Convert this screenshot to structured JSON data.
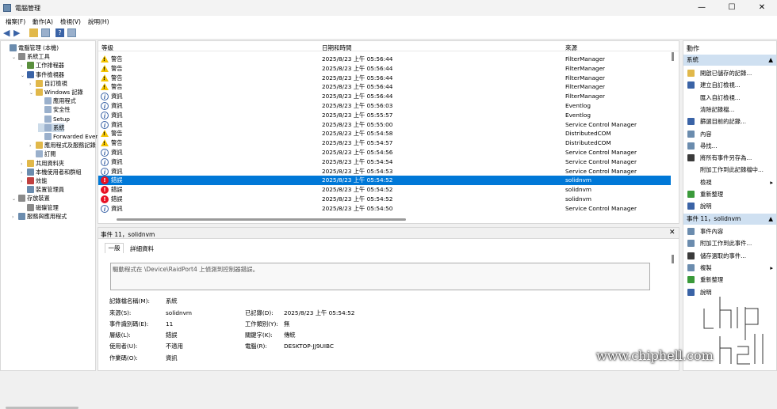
{
  "window": {
    "title": "電腦管理",
    "minimize": "—",
    "maximize": "☐",
    "close": "✕"
  },
  "menu": [
    "檔案(F)",
    "動作(A)",
    "檢視(V)",
    "說明(H)"
  ],
  "tree": [
    {
      "label": "電腦管理 (本機)",
      "indent": 0,
      "tw": "",
      "icon": "#6b8cae"
    },
    {
      "label": "系統工具",
      "indent": 1,
      "tw": "v",
      "icon": "#8a8a8a"
    },
    {
      "label": "工作排程器",
      "indent": 2,
      "tw": ">",
      "icon": "#5a8f3e"
    },
    {
      "label": "事件檢視器",
      "indent": 2,
      "tw": "v",
      "icon": "#3a63a6"
    },
    {
      "label": "自訂檢視",
      "indent": 3,
      "tw": ">",
      "icon": "#e1b84a"
    },
    {
      "label": "Windows 記錄",
      "indent": 3,
      "tw": "v",
      "icon": "#e1b84a"
    },
    {
      "label": "應用程式",
      "indent": 4,
      "tw": "",
      "icon": "#9ab0cc"
    },
    {
      "label": "安全性",
      "indent": 4,
      "tw": "",
      "icon": "#9ab0cc"
    },
    {
      "label": "Setup",
      "indent": 4,
      "tw": "",
      "icon": "#9ab0cc"
    },
    {
      "label": "系統",
      "indent": 4,
      "tw": "",
      "icon": "#9ab0cc",
      "selected": true
    },
    {
      "label": "Forwarded Even",
      "indent": 4,
      "tw": "",
      "icon": "#9ab0cc"
    },
    {
      "label": "應用程式及服務記錄",
      "indent": 3,
      "tw": ">",
      "icon": "#e1b84a"
    },
    {
      "label": "訂閱",
      "indent": 3,
      "tw": "",
      "icon": "#9ab0cc"
    },
    {
      "label": "共用資料夾",
      "indent": 2,
      "tw": ">",
      "icon": "#e1b84a"
    },
    {
      "label": "本機使用者和群組",
      "indent": 2,
      "tw": ">",
      "icon": "#6b8cae"
    },
    {
      "label": "效能",
      "indent": 2,
      "tw": ">",
      "icon": "#c04040"
    },
    {
      "label": "裝置管理員",
      "indent": 2,
      "tw": "",
      "icon": "#6b8cae"
    },
    {
      "label": "存放裝置",
      "indent": 1,
      "tw": "v",
      "icon": "#8a8a8a"
    },
    {
      "label": "磁碟管理",
      "indent": 2,
      "tw": "",
      "icon": "#8a8a8a"
    },
    {
      "label": "服務與應用程式",
      "indent": 1,
      "tw": ">",
      "icon": "#6b8cae"
    }
  ],
  "events": {
    "columns": [
      "等級",
      "日期和時間",
      "來源"
    ],
    "rows": [
      {
        "level": "警告",
        "type": "warn",
        "time": "2025/8/23 上午 05:56:44",
        "source": "FilterManager"
      },
      {
        "level": "警告",
        "type": "warn",
        "time": "2025/8/23 上午 05:56:44",
        "source": "FilterManager"
      },
      {
        "level": "警告",
        "type": "warn",
        "time": "2025/8/23 上午 05:56:44",
        "source": "FilterManager"
      },
      {
        "level": "警告",
        "type": "warn",
        "time": "2025/8/23 上午 05:56:44",
        "source": "FilterManager"
      },
      {
        "level": "資訊",
        "type": "info",
        "time": "2025/8/23 上午 05:56:44",
        "source": "FilterManager"
      },
      {
        "level": "資訊",
        "type": "info",
        "time": "2025/8/23 上午 05:56:03",
        "source": "Eventlog"
      },
      {
        "level": "資訊",
        "type": "info",
        "time": "2025/8/23 上午 05:55:57",
        "source": "Eventlog"
      },
      {
        "level": "資訊",
        "type": "info",
        "time": "2025/8/23 上午 05:55:00",
        "source": "Service Control Manager"
      },
      {
        "level": "警告",
        "type": "warn",
        "time": "2025/8/23 上午 05:54:58",
        "source": "DistributedCOM"
      },
      {
        "level": "警告",
        "type": "warn",
        "time": "2025/8/23 上午 05:54:57",
        "source": "DistributedCOM"
      },
      {
        "level": "資訊",
        "type": "info",
        "time": "2025/8/23 上午 05:54:56",
        "source": "Service Control Manager"
      },
      {
        "level": "資訊",
        "type": "info",
        "time": "2025/8/23 上午 05:54:54",
        "source": "Service Control Manager"
      },
      {
        "level": "資訊",
        "type": "info",
        "time": "2025/8/23 上午 05:54:53",
        "source": "Service Control Manager"
      },
      {
        "level": "錯誤",
        "type": "err",
        "time": "2025/8/23 上午 05:54:52",
        "source": "solidnvm",
        "selected": true
      },
      {
        "level": "錯誤",
        "type": "err",
        "time": "2025/8/23 上午 05:54:52",
        "source": "solidnvm"
      },
      {
        "level": "錯誤",
        "type": "err",
        "time": "2025/8/23 上午 05:54:52",
        "source": "solidnvm"
      },
      {
        "level": "資訊",
        "type": "info",
        "time": "2025/8/23 上午 05:54:50",
        "source": "Service Control Manager"
      }
    ]
  },
  "detail": {
    "header": "事件 11，solidnvm",
    "tabs": [
      "一般",
      "詳細資料"
    ],
    "message": "驅動程式在 \\Device\\RaidPort4 上偵測到控制器錯誤。",
    "labels": {
      "log_name": "記錄檔名稱(M):",
      "source": "來源(S):",
      "event_id": "事件識別碼(E):",
      "level": "層級(L):",
      "user": "使用者(U):",
      "opcode": "作業碼(O):",
      "logged": "已記錄(D):",
      "task": "工作類別(Y):",
      "keywords": "關鍵字(K):",
      "computer": "電腦(R):"
    },
    "values": {
      "log_name": "系統",
      "source": "solidnvm",
      "event_id": "11",
      "level": "錯誤",
      "user": "不適用",
      "opcode": "資訊",
      "logged": "2025/8/23 上午 05:54:52",
      "task": "無",
      "keywords": "傳統",
      "computer": "DESKTOP-JJ9UIBC"
    }
  },
  "actions": {
    "title": "動作",
    "section1": "系統",
    "items1": [
      {
        "label": "開啟已儲存的記錄...",
        "icon": "#e1b84a"
      },
      {
        "label": "建立自訂檢視...",
        "icon": "#3a63a6"
      },
      {
        "label": "匯入自訂檢視...",
        "icon": ""
      },
      {
        "label": "清除記錄檔...",
        "icon": ""
      },
      {
        "label": "篩選目前的記錄...",
        "icon": "#3a63a6"
      },
      {
        "label": "內容",
        "icon": "#6b8cae"
      },
      {
        "label": "尋找...",
        "icon": "#6b8cae"
      },
      {
        "label": "將所有事件另存為...",
        "icon": "#3a3a3a"
      },
      {
        "label": "附加工作到此記錄檔中...",
        "icon": ""
      },
      {
        "label": "檢視",
        "icon": "",
        "arrow": "▸"
      },
      {
        "label": "重新整理",
        "icon": "#3a9a3a"
      },
      {
        "label": "說明",
        "icon": "#3a63a6"
      }
    ],
    "section2": "事件 11，solidnvm",
    "items2": [
      {
        "label": "事件內容",
        "icon": "#6b8cae"
      },
      {
        "label": "附加工作到此事件...",
        "icon": "#6b8cae"
      },
      {
        "label": "儲存選取的事件...",
        "icon": "#3a3a3a"
      },
      {
        "label": "複製",
        "icon": "#6b8cae",
        "arrow": "▸"
      },
      {
        "label": "重新整理",
        "icon": "#3a9a3a"
      },
      {
        "label": "說明",
        "icon": "#3a63a6"
      }
    ]
  },
  "watermark": "www.chiphell.com",
  "logo": "chip hell"
}
